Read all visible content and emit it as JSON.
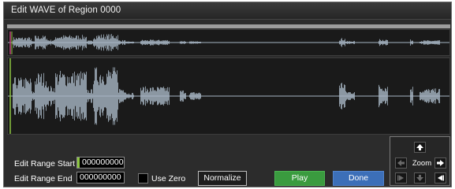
{
  "window": {
    "title": "Edit WAVE of Region 0000"
  },
  "edit_range": {
    "start_label": "Edit Range Start",
    "start_value": "000000000",
    "end_label": "Edit Range End",
    "end_value": "000000000"
  },
  "options": {
    "use_zero_label": "Use Zero",
    "use_zero_checked": false
  },
  "buttons": {
    "normalize_label": "Normalize",
    "play_label": "Play",
    "done_label": "Done"
  },
  "zoom": {
    "label": "Zoom",
    "controls": [
      {
        "name": "zoom-up",
        "icon": "arrow-up-icon",
        "enabled": true
      },
      {
        "name": "zoom-left",
        "icon": "arrow-left-icon",
        "enabled": false
      },
      {
        "name": "zoom-right",
        "icon": "arrow-right-icon",
        "enabled": true
      },
      {
        "name": "zoom-to-start",
        "icon": "skip-start-icon",
        "enabled": false
      },
      {
        "name": "zoom-down",
        "icon": "arrow-down-icon",
        "enabled": false
      },
      {
        "name": "zoom-to-end",
        "icon": "skip-end-icon",
        "enabled": true
      }
    ]
  },
  "colors": {
    "waveform": "#a7b6c4",
    "marker_green": "#8cc63f",
    "play_button": "#3a9b3f",
    "done_button": "#3c6fb8"
  }
}
